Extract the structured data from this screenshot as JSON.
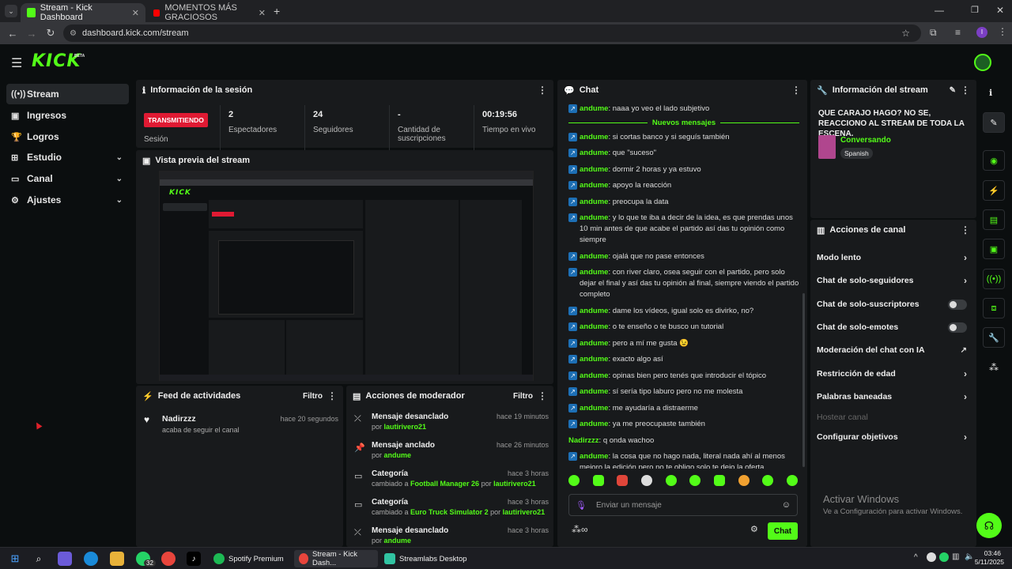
{
  "browser": {
    "tabs": [
      {
        "title": "Stream - Kick Dashboard",
        "active": true
      },
      {
        "title": "MOMENTOS MÁS GRACIOSOS",
        "active": false
      }
    ],
    "url": "dashboard.kick.com/stream"
  },
  "brand": {
    "logo": "KICK",
    "badge": "BETA",
    "accent": "#53fc18"
  },
  "sidebar": {
    "items": [
      {
        "label": "Stream",
        "icon": "broadcast-icon",
        "active": true
      },
      {
        "label": "Ingresos",
        "icon": "wallet-icon"
      },
      {
        "label": "Logros",
        "icon": "trophy-icon"
      },
      {
        "label": "Estudio",
        "icon": "studio-icon",
        "expandable": true
      },
      {
        "label": "Canal",
        "icon": "channel-icon",
        "expandable": true
      },
      {
        "label": "Ajustes",
        "icon": "gear-icon",
        "expandable": true
      }
    ]
  },
  "session": {
    "title": "Información de la sesión",
    "status_badge": "TRANSMITIENDO",
    "status_label": "Sesión",
    "stats": [
      {
        "value": "2",
        "label": "Espectadores"
      },
      {
        "value": "24",
        "label": "Seguidores"
      },
      {
        "value": "-",
        "label": "Cantidad de suscripciones"
      },
      {
        "value": "00:19:56",
        "label": "Tiempo en vivo"
      }
    ]
  },
  "preview": {
    "title": "Vista previa del stream"
  },
  "activity": {
    "title": "Feed de actividades",
    "filter": "Filtro",
    "items": [
      {
        "user": "Nadirzzz",
        "text": "acaba de seguir el canal",
        "time": "hace 20 segundos"
      }
    ]
  },
  "mod_actions": {
    "title": "Acciones de moderador",
    "filter": "Filtro",
    "items": [
      {
        "title": "Mensaje desanclado",
        "prefix": "por",
        "target": "lautirivero21",
        "suffix": "",
        "extra": "",
        "time": "hace 19 minutos",
        "icon": "unpin-icon"
      },
      {
        "title": "Mensaje anclado",
        "prefix": "por",
        "target": "andume",
        "suffix": "",
        "extra": "",
        "time": "hace 26 minutos",
        "icon": "pin-icon"
      },
      {
        "title": "Categoría",
        "prefix": "cambiado a",
        "target": "Football Manager 26",
        "suffix": "por",
        "extra": "lautirivero21",
        "time": "hace 3 horas",
        "icon": "category-icon"
      },
      {
        "title": "Categoría",
        "prefix": "cambiado a",
        "target": "Euro Truck Simulator 2",
        "suffix": "por",
        "extra": "lautirivero21",
        "time": "hace 3 horas",
        "icon": "category-icon"
      },
      {
        "title": "Mensaje desanclado",
        "prefix": "por",
        "target": "andume",
        "suffix": "",
        "extra": "",
        "time": "hace 3 horas",
        "icon": "unpin-icon"
      }
    ]
  },
  "chat": {
    "title": "Chat",
    "new_messages": "Nuevos mensajes",
    "messages": [
      {
        "user": "andume",
        "text": "naaa yo veo el lado subjetivo",
        "badge": true
      },
      {
        "user": "andume",
        "text": "si cortas banco y si seguís también",
        "badge": true
      },
      {
        "user": "andume",
        "text": "que \"suceso\"",
        "badge": true
      },
      {
        "user": "andume",
        "text": "dormir 2 horas y ya estuvo",
        "badge": true
      },
      {
        "user": "andume",
        "text": "apoyo la reacción",
        "badge": true
      },
      {
        "user": "andume",
        "text": "preocupa la data",
        "badge": true
      },
      {
        "user": "andume",
        "text": "y lo que te iba a decir de la idea, es que prendas unos 10 min antes de que acabe el partido así das tu opinión como siempre",
        "badge": true
      },
      {
        "user": "andume",
        "text": "ojalá que no pase entonces",
        "badge": true
      },
      {
        "user": "andume",
        "text": "con river claro, osea seguir con el partido, pero solo dejar el final y así das tu opinión al final, siempre viendo el partido completo",
        "badge": true
      },
      {
        "user": "andume",
        "text": "dame los vídeos, igual solo es divirko, no?",
        "badge": true
      },
      {
        "user": "andume",
        "text": "o te enseño o te busco un tutorial",
        "badge": true
      },
      {
        "user": "andume",
        "text": "pero a mí me gusta 😉",
        "badge": true
      },
      {
        "user": "andume",
        "text": "exacto algo así",
        "badge": true
      },
      {
        "user": "andume",
        "text": "opinas bien pero tenés que introducir el tópico",
        "badge": true
      },
      {
        "user": "andume",
        "text": "sí sería tipo laburo pero no me molesta",
        "badge": true
      },
      {
        "user": "andume",
        "text": "me ayudaría a distraerme",
        "badge": true
      },
      {
        "user": "andume",
        "text": "ya me preocupaste también",
        "badge": true
      },
      {
        "user": "Nadirzzz",
        "text": "q onda wachoo",
        "badge": false
      },
      {
        "user": "andume",
        "text": "la cosa que no hago nada, literal nada ahí al menos mejoro la edición pero no te obligo solo te dejo la oferta",
        "badge": true
      }
    ],
    "input_placeholder": "Enviar un mensaje",
    "send_label": "Chat"
  },
  "stream_info": {
    "title": "Información del stream",
    "stream_title": "QUE CARAJO HAGO? NO SE, REACCIONO AL STREAM DE TODA LA ESCENA.",
    "category": "Conversando",
    "language": "Spanish"
  },
  "channel_actions": {
    "title": "Acciones de canal",
    "items": [
      {
        "label": "Modo lento",
        "control": "chevron"
      },
      {
        "label": "Chat de solo-seguidores",
        "control": "chevron"
      },
      {
        "label": "Chat de solo-suscriptores",
        "control": "toggle"
      },
      {
        "label": "Chat de solo-emotes",
        "control": "toggle"
      },
      {
        "label": "Moderación del chat con IA",
        "control": "external"
      },
      {
        "label": "Restricción de edad",
        "control": "chevron"
      },
      {
        "label": "Palabras baneadas",
        "control": "chevron"
      },
      {
        "label": "Hostear canal",
        "control": "disabled"
      },
      {
        "label": "Configurar objetivos",
        "control": "chevron"
      }
    ]
  },
  "watermark": {
    "line1": "Activar Windows",
    "line2": "Ve a Configuración para activar Windows."
  },
  "taskbar": {
    "apps": [
      "Spotify Premium",
      "Stream - Kick Dash...",
      "Streamlabs Desktop"
    ],
    "whatsapp_badge": "32",
    "time": "03:46",
    "date": "5/11/2025"
  }
}
